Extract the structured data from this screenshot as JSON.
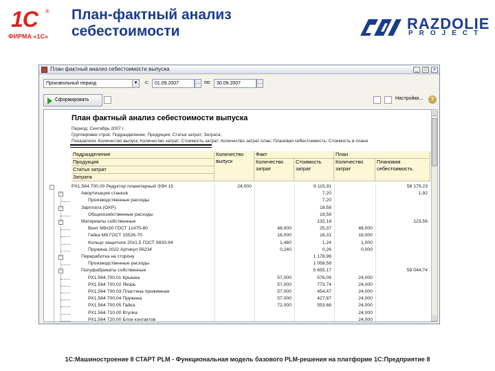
{
  "slide": {
    "title_line1": "План-фактный анализ",
    "title_line2": "себестоимости",
    "logo_mark": "1С",
    "logo_reg": "®",
    "logo_firm": "ФИРМА «1С»",
    "partner_name": "RAZDOLIE",
    "partner_sub": "PROJECT",
    "footer": "1С:Машиностроение 8 СТАРТ PLM - Функциональная модель базового PLM-решения на платформе 1С:Предприятие 8"
  },
  "window": {
    "title": "План фактный анализ себестоимости выпуска",
    "period_select": "Произвольный период",
    "from_label": "с:",
    "from_date": "01.09.2007",
    "to_label": "по:",
    "to_date": "30.09.2007",
    "generate_label": "Сформировать",
    "settings_label": "Настройки..."
  },
  "report": {
    "title": "План фактный анализ себестоимости выпуска",
    "period_line": "Период: Сентябрь 2007 г.",
    "grouping_line": "Группировки строк: Подразделение; Продукция; Статья затрат; Затрата;",
    "indicators_line": "Показатели: Количество выпуск; Количество затрат; Стоимость затрат; Количество затрат план; Плановая себестоимость; Стоимость в плане",
    "headers": {
      "row_dims": [
        "Подразделение",
        "Продукция",
        "Статья затрат",
        "Затрата"
      ],
      "qty_top": "Количество",
      "qty_sub": "выпуск",
      "fact": "Факт",
      "fact_qty": "Количество затрат",
      "fact_cost": "Стоимость затрат",
      "plan": "План",
      "plan_qty": "Количество затрат",
      "plan_cost": "Плановая себестоимость"
    },
    "rows": [
      {
        "label": "РХ1.564.700.00 Редуктор планетарный ЭЗН 15",
        "level": 0,
        "qty": "24,000",
        "fqty": "",
        "fcost": "9 115,91",
        "pqty": "",
        "pcost": "58 175,23"
      },
      {
        "label": "Амортизация станков",
        "level": 1,
        "qty": "",
        "fqty": "",
        "fcost": "7,20",
        "pqty": "",
        "pcost": "1,92"
      },
      {
        "label": "Производственные расходы",
        "level": 2,
        "qty": "",
        "fqty": "",
        "fcost": "7,20",
        "pqty": "",
        "pcost": ""
      },
      {
        "label": "Зарплата (ОХР)",
        "level": 1,
        "qty": "",
        "fqty": "",
        "fcost": "18,58",
        "pqty": "",
        "pcost": ""
      },
      {
        "label": "Общехозяйственные расходы",
        "level": 2,
        "qty": "",
        "fqty": "",
        "fcost": "18,58",
        "pqty": "",
        "pcost": ""
      },
      {
        "label": "Материалы собственные",
        "level": 1,
        "qty": "",
        "fqty": "",
        "fcost": "132,18",
        "pqty": "",
        "pcost": "123,56"
      },
      {
        "label": "Винт М8х30 ГОСТ 11475-80",
        "level": 2,
        "qty": "",
        "fqty": "48,000",
        "fcost": "25,37",
        "pqty": "48,000",
        "pcost": ""
      },
      {
        "label": "Гайка М8 ГОСТ 15526-70",
        "level": 2,
        "qty": "",
        "fqty": "18,000",
        "fcost": "16,31",
        "pqty": "18,000",
        "pcost": ""
      },
      {
        "label": "Кольцо защитное 20х1,5 ГОСТ 9833-84",
        "level": 2,
        "qty": "",
        "fqty": "1,480",
        "fcost": "1,24",
        "pqty": "1,000",
        "pcost": ""
      },
      {
        "label": "Пружина 2022 Артикул 56234",
        "level": 2,
        "qty": "",
        "fqty": "0,240",
        "fcost": "0,26",
        "pqty": "0,000",
        "pcost": ""
      },
      {
        "label": "Переработка на сторону",
        "level": 1,
        "qty": "",
        "fqty": "",
        "fcost": "1 178,98",
        "pqty": "",
        "pcost": ""
      },
      {
        "label": "Производственные расходы",
        "level": 2,
        "qty": "",
        "fqty": "",
        "fcost": "1 058,58",
        "pqty": "",
        "pcost": ""
      },
      {
        "label": "Полуфабрикаты собственные",
        "level": 1,
        "qty": "",
        "fqty": "",
        "fcost": "5 655,17",
        "pqty": "",
        "pcost": "58 044,74"
      },
      {
        "label": "РХ1.564.700.01 Крышка",
        "level": 2,
        "qty": "",
        "fqty": "57,000",
        "fcost": "576,09",
        "pqty": "24,000",
        "pcost": ""
      },
      {
        "label": "РХ1.564 700.02 Якорь",
        "level": 2,
        "qty": "",
        "fqty": "57,000",
        "fcost": "773,74",
        "pqty": "24,000",
        "pcost": ""
      },
      {
        "label": "РХ1.564 700.03 Пластина прижимная",
        "level": 2,
        "qty": "",
        "fqty": "57,000",
        "fcost": "454,47",
        "pqty": "24,000",
        "pcost": ""
      },
      {
        "label": "РХ1.564 700.04 Пружина",
        "level": 2,
        "qty": "",
        "fqty": "57,000",
        "fcost": "427,87",
        "pqty": "24,000",
        "pcost": ""
      },
      {
        "label": "РХ1.564 700.05 Гайка",
        "level": 2,
        "qty": "",
        "fqty": "72,000",
        "fcost": "553,68",
        "pqty": "24,000",
        "pcost": ""
      },
      {
        "label": "РХ1.564 710.00 Втулка",
        "level": 2,
        "qty": "",
        "fqty": "",
        "fcost": "",
        "pqty": "24,000",
        "pcost": ""
      },
      {
        "label": "РХ1.564 720.00 Блок контактов",
        "level": 2,
        "qty": "",
        "fqty": "",
        "fcost": "",
        "pqty": "24,000",
        "pcost": ""
      }
    ]
  }
}
